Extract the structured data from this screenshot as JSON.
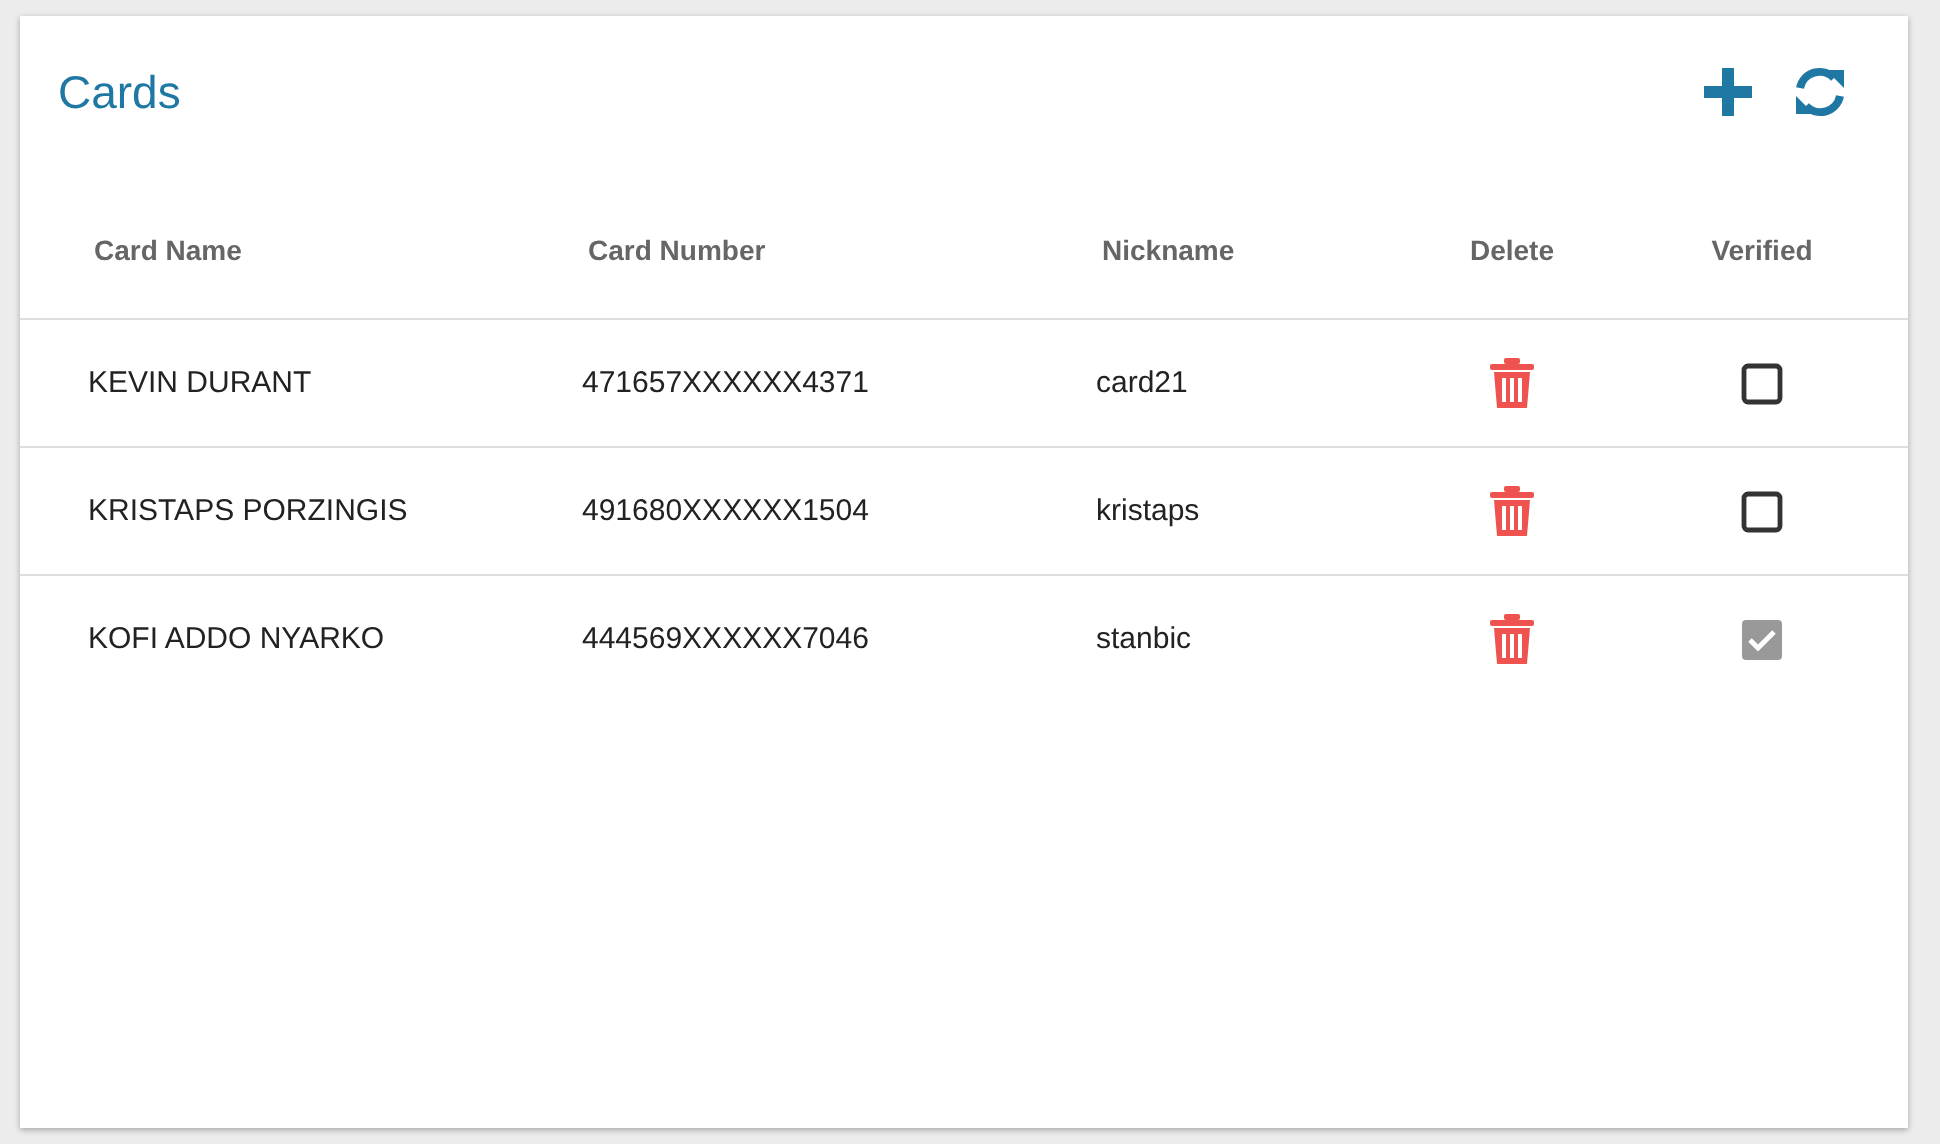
{
  "title": "Cards",
  "columns": [
    "Card Name",
    "Card Number",
    "Nickname",
    "Delete",
    "Verified"
  ],
  "rows": [
    {
      "name": "KEVIN DURANT",
      "number": "471657XXXXXX4371",
      "nickname": "card21",
      "checked": false
    },
    {
      "name": "KRISTAPS PORZINGIS",
      "number": "491680XXXXXX1504",
      "nickname": "kristaps",
      "checked": false
    },
    {
      "name": "KOFI ADDO NYARKO",
      "number": "444569XXXXXX7046",
      "nickname": "stanbic",
      "checked": true
    }
  ]
}
